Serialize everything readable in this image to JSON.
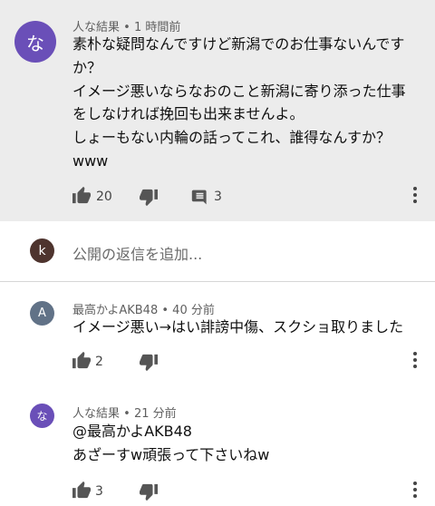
{
  "comments": [
    {
      "avatar_letter": "な",
      "avatar_color": "#6a4fb8",
      "author": "人な結果",
      "time": "1 時間前",
      "lines": [
        "素朴な疑問なんですけど新潟でのお仕事ないんです",
        "か？",
        "イメージ悪いならなおのこと新潟に寄り添った仕事",
        "をしなければ挽回も出来ませんよ。",
        "しょーもない内輪の話ってこれ、誰得なんすか？",
        "www"
      ],
      "likes": "20",
      "replies": "3"
    },
    {
      "avatar_letter": "A",
      "avatar_color": "#617287",
      "author": "最高かよAKB48",
      "time": "40 分前",
      "lines": [
        "イメージ悪い→はい誹謗中傷、スクショ取りました"
      ],
      "likes": "2"
    },
    {
      "avatar_letter": "な",
      "avatar_color": "#6a4fb8",
      "author": "人な結果",
      "time": "21 分前",
      "lines": [
        "@最高かよAKB48",
        "あざーすw頑張って下さいねw"
      ],
      "likes": "3"
    }
  ],
  "reply_box": {
    "avatar_letter": "k",
    "avatar_color": "#4e342e",
    "placeholder": "公開の返信を追加..."
  },
  "separator": " • ",
  "icons": {
    "like": "thumb-up-icon",
    "dislike": "thumb-down-icon",
    "reply": "comment-icon",
    "more": "more-vert-icon"
  }
}
